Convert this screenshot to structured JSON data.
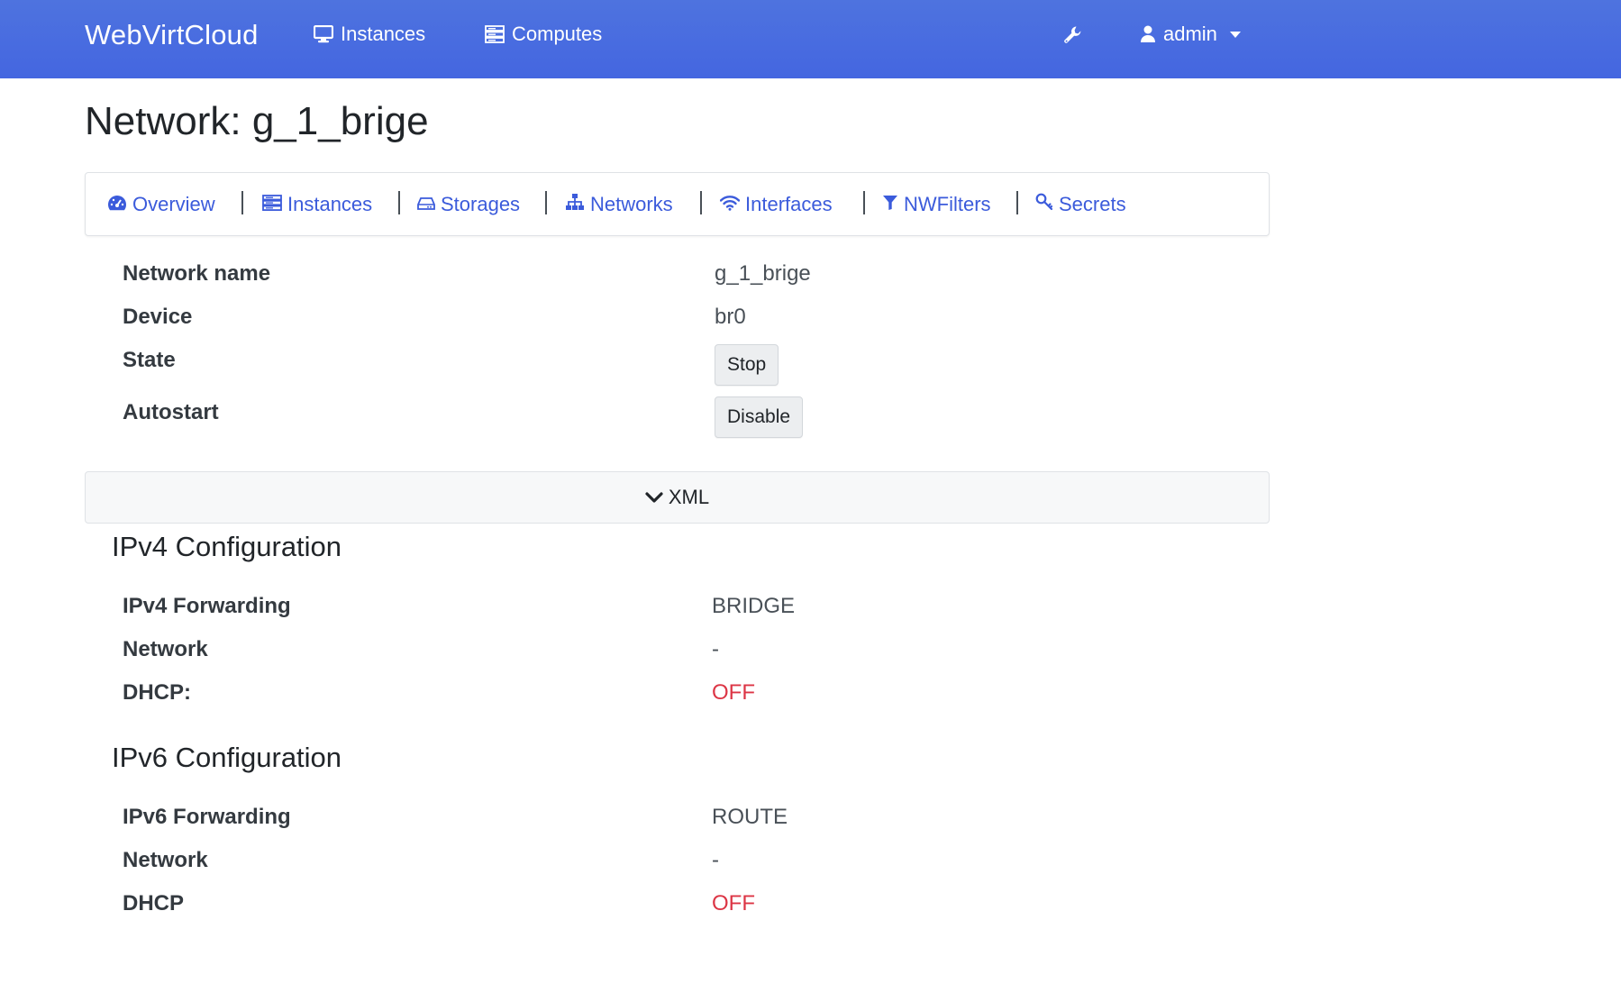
{
  "navbar": {
    "brand": "WebVirtCloud",
    "instances_label": "Instances",
    "computes_label": "Computes",
    "user_label": "admin"
  },
  "page": {
    "title": "Network: g_1_brige"
  },
  "subnav": {
    "items": [
      {
        "label": "Overview",
        "icon": "tachometer-icon"
      },
      {
        "label": "Instances",
        "icon": "server-icon"
      },
      {
        "label": "Storages",
        "icon": "hdd-icon"
      },
      {
        "label": "Networks",
        "icon": "sitemap-icon"
      },
      {
        "label": "Interfaces",
        "icon": "wifi-icon"
      },
      {
        "label": "NWFilters",
        "icon": "filter-icon"
      },
      {
        "label": "Secrets",
        "icon": "key-icon"
      }
    ]
  },
  "details": {
    "network_name_label": "Network name",
    "network_name_value": "g_1_brige",
    "device_label": "Device",
    "device_value": "br0",
    "state_label": "State",
    "state_button": "Stop",
    "autostart_label": "Autostart",
    "autostart_button": "Disable"
  },
  "xml": {
    "label": "XML"
  },
  "ipv4": {
    "title": "IPv4 Configuration",
    "forwarding_label": "IPv4 Forwarding",
    "forwarding_value": "BRIDGE",
    "network_label": "Network",
    "network_value": "-",
    "dhcp_label": "DHCP:",
    "dhcp_value": "OFF"
  },
  "ipv6": {
    "title": "IPv6 Configuration",
    "forwarding_label": "IPv6 Forwarding",
    "forwarding_value": "ROUTE",
    "network_label": "Network",
    "network_value": "-",
    "dhcp_label": "DHCP",
    "dhcp_value": "OFF"
  },
  "colors": {
    "navbar": "#4a6de0",
    "link": "#3b5bdb",
    "off": "#dc3545"
  }
}
